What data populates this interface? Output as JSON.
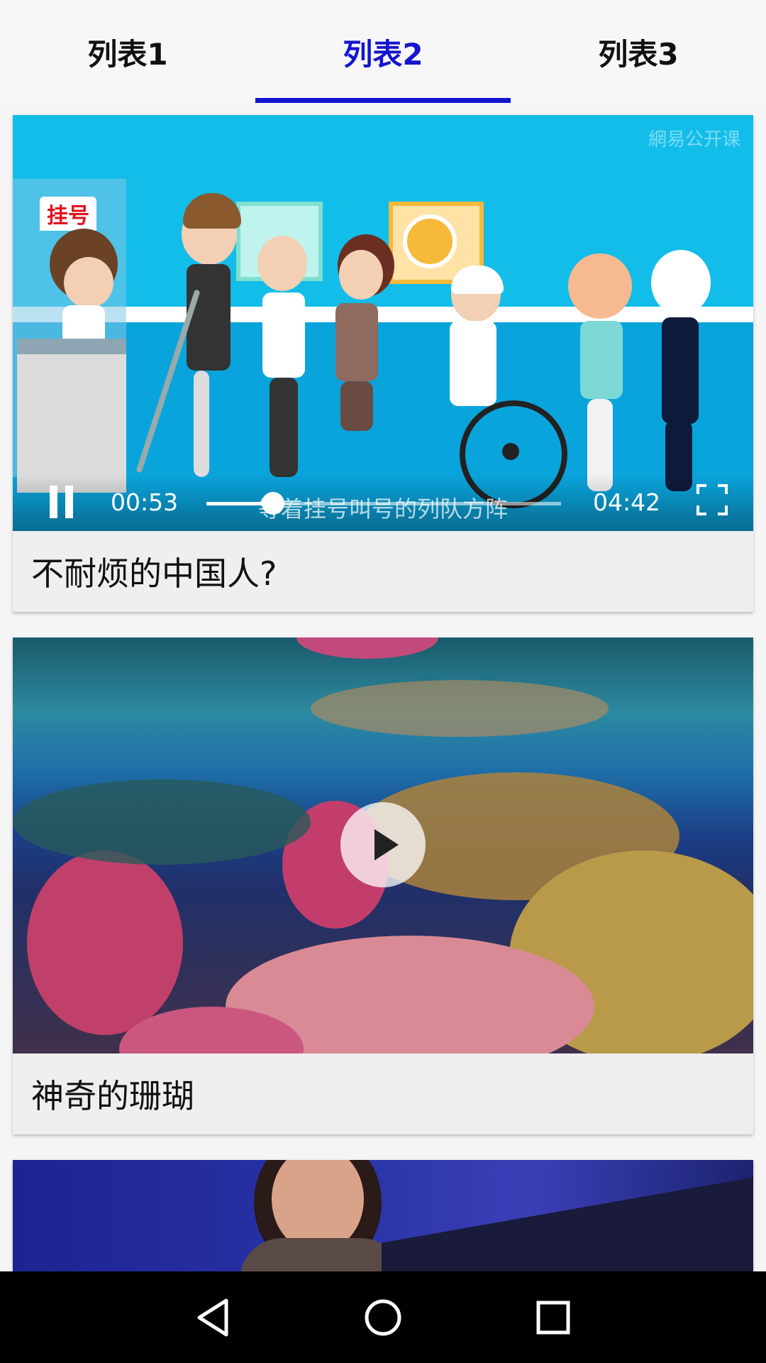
{
  "theme": {
    "accent": "#1414d0",
    "nav_bg": "#000000",
    "icon_color": "#ffffff"
  },
  "tabs": [
    {
      "label": "列表1",
      "active": false
    },
    {
      "label": "列表2",
      "active": true
    },
    {
      "label": "列表3",
      "active": false
    }
  ],
  "videos": [
    {
      "title": "不耐烦的中国人?",
      "state": "playing",
      "current_time": "00:53",
      "total_time": "04:42",
      "progress": 0.188,
      "subtitle": "等着挂号叫号的列队方阵",
      "watermark": "網易公开课",
      "sign_text": "挂号",
      "icons": [
        "pause-icon",
        "fullscreen-icon"
      ]
    },
    {
      "title": "神奇的珊瑚",
      "state": "paused",
      "icons": [
        "play-icon"
      ]
    },
    {
      "title": "",
      "state": "thumbnail"
    }
  ],
  "navbar": {
    "icons": [
      "back-icon",
      "home-icon",
      "recents-icon"
    ]
  }
}
